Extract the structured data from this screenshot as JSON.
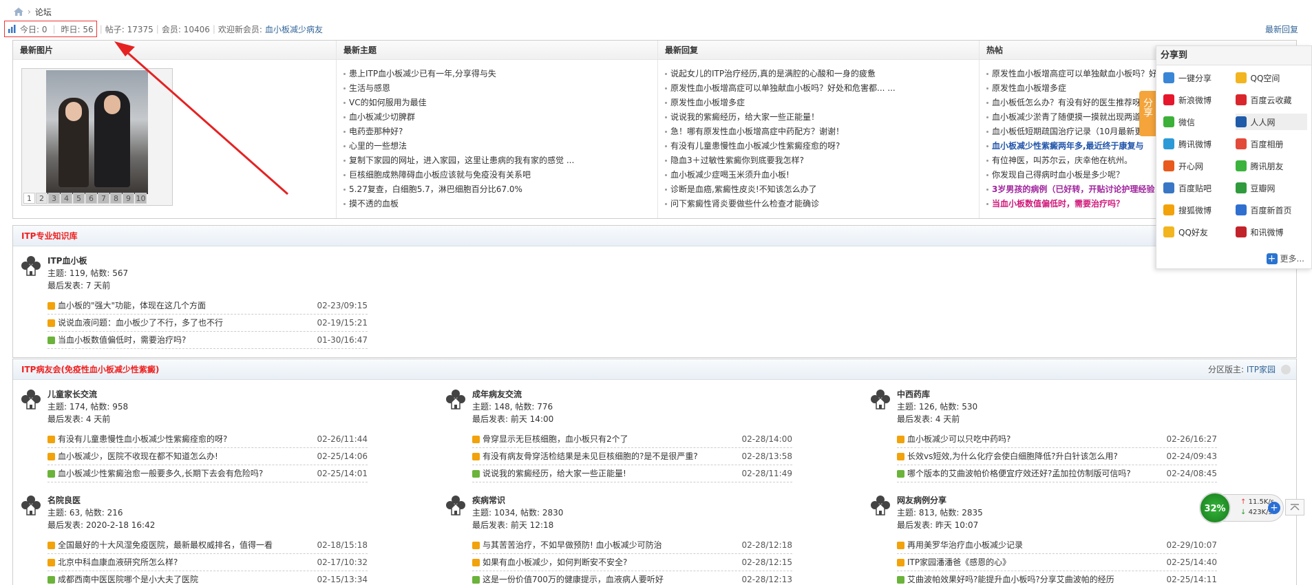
{
  "breadcrumb": {
    "current": "论坛"
  },
  "stats": {
    "today": "今日: 0",
    "yesterday": "昨日: 56",
    "posts": "帖子: 17375",
    "members": "会员: 10406",
    "welcome": "欢迎新会员:",
    "newest_member": "血小板减少病友"
  },
  "latest_reply_link": "最新回复",
  "hot": {
    "columns": [
      {
        "title": "最新图片"
      },
      {
        "title": "最新主题"
      },
      {
        "title": "最新回复"
      },
      {
        "title": "热帖"
      }
    ],
    "pager": [
      "1",
      "2",
      "3",
      "4",
      "5",
      "6",
      "7",
      "8",
      "9",
      "10"
    ],
    "new_topics": [
      "患上ITP血小板减少已有一年,分享得与失",
      "生活与感恩",
      "VC的如何服用为最佳",
      "血小板减少切脾群",
      "电药壶那种好?",
      "心里的一些想法",
      "复制下家园的网址，进入家园，这里让患病的我有家的感觉 ...",
      "巨核细胞成熟障碍血小板应该就与免疫没有关系吧",
      "5.27复查，白细胞5.7，淋巴细胞百分比67.0%",
      "摸不透的血板"
    ],
    "new_replies": [
      "说起女儿的ITP治疗经历,真的是满腔的心酸和一身的疲惫",
      "原发性血小板增高症可以单独献血小板吗？好处和危害都... ...",
      "原发性血小板增多症",
      "说说我的紫癜经历，给大家一些正能量！",
      "急！哪有原发性血小板增高症中药配方？谢谢！",
      "有没有儿童患慢性血小板减少性紫癜痊愈的呀?",
      "隐血3＋过敏性紫癜你到底要我怎样?",
      "血小板减少症喝玉米须升血小板!",
      "诊断是血癌,紫癜性皮炎!不知该怎么办了",
      "问下紫癜性肾炎要做些什么检查才能确诊"
    ],
    "hot_posts": [
      {
        "text": "原发性血小板增高症可以单独献血小板吗？好",
        "style": ""
      },
      {
        "text": "原发性血小板增多症",
        "style": ""
      },
      {
        "text": "血小板低怎么办？有没有好的医生推荐呀",
        "style": ""
      },
      {
        "text": "血小板减少淤青了随便摸一摸就出现两道",
        "style": ""
      },
      {
        "text": "血小板低短期疏国治疗记录（10月最新更",
        "style": ""
      },
      {
        "text": "血小板减少性紫癜两年多,最近终于康复与",
        "style": "bold-blue"
      },
      {
        "text": "有位神医，叫苏尔云，庆幸他在杭州。",
        "style": ""
      },
      {
        "text": "你发现自己得病时血小板是多少呢？",
        "style": ""
      },
      {
        "text": "3岁男孩的病例（已好转，开贴讨论护理经验",
        "style": "bold-purple"
      },
      {
        "text": "当血小板数值偏低时，需要治疗吗？",
        "style": "bold-pink"
      }
    ]
  },
  "sections": [
    {
      "title": "ITP专业知识库",
      "forums": [
        {
          "name": "ITP血小板",
          "stats": "主题: 119, 帖数: 567",
          "last": "最后发表: 7 天前",
          "threads": [
            {
              "title": "血小板的\"强大\"功能，体现在这几个方面",
              "date": "02-23/09:15",
              "icon": "o"
            },
            {
              "title": "说说血液问题：血小板少了不行，多了也不行",
              "date": "02-19/15:21",
              "icon": "o"
            },
            {
              "title": "当血小板数值偏低时，需要治疗吗?",
              "date": "01-30/16:47",
              "icon": "g"
            }
          ]
        }
      ]
    },
    {
      "title": "ITP病友会(免疫性血小板减少性紫癜)",
      "moderator_label": "分区版主:",
      "moderator": "ITP家园",
      "forums": [
        {
          "name": "儿童家长交流",
          "stats": "主题: 174, 帖数: 958",
          "last": "最后发表: 4 天前",
          "threads": [
            {
              "title": "有没有儿童患慢性血小板减少性紫癜痊愈的呀?",
              "date": "02-26/11:44",
              "icon": "o"
            },
            {
              "title": "血小板减少，医院不收现在都不知道怎么办!",
              "date": "02-25/14:06",
              "icon": "o"
            },
            {
              "title": "血小板减少性紫癜治愈一般要多久,长期下去会有危险吗?",
              "date": "02-25/14:01",
              "icon": "g"
            }
          ]
        },
        {
          "name": "成年病友交流",
          "stats": "主题: 148, 帖数: 776",
          "last": "最后发表: 前天 14:00",
          "threads": [
            {
              "title": "骨穿显示无巨核细胞，血小板只有2个了",
              "date": "02-28/14:00",
              "icon": "o"
            },
            {
              "title": "有没有病友骨穿活检结果是未见巨核细胞的?是不是很严重?",
              "date": "02-28/13:58",
              "icon": "o"
            },
            {
              "title": "说说我的紫癜经历，给大家一些正能量!",
              "date": "02-28/11:49",
              "icon": "g"
            }
          ]
        },
        {
          "name": "中西药库",
          "stats": "主题: 126, 帖数: 530",
          "last": "最后发表: 4 天前",
          "threads": [
            {
              "title": "血小板减少可以只吃中药吗?",
              "date": "02-26/16:27",
              "icon": "o"
            },
            {
              "title": "长效vs短效,为什么化疗会使白细胞降低?升白针该怎么用?",
              "date": "02-24/09:43",
              "icon": "o"
            },
            {
              "title": "哪个版本的艾曲波帕价格便宜疗效还好?孟加拉仿制版可信吗?",
              "date": "02-24/08:45",
              "icon": "g"
            }
          ]
        },
        {
          "name": "名院良医",
          "stats": "主题: 63, 帖数: 216",
          "last": "最后发表: 2020-2-18 16:42",
          "threads": [
            {
              "title": "全国最好的十大风湿免疫医院，最新最权威排名，值得一看",
              "date": "02-18/15:18",
              "icon": "o"
            },
            {
              "title": "北京中科血康血液研究所怎么样?",
              "date": "02-17/10:32",
              "icon": "o"
            },
            {
              "title": "成都西南中医医院哪个是小大夫了医院",
              "date": "02-15/13:34",
              "icon": "g"
            }
          ]
        },
        {
          "name": "疾病常识",
          "stats": "主题: 1034, 帖数: 2830",
          "last": "最后发表: 前天 12:18",
          "threads": [
            {
              "title": "与其苦苦治疗，不如早做预防! 血小板减少可防治",
              "date": "02-28/12:18",
              "icon": "o"
            },
            {
              "title": "如果有血小板减少，如何判断安不安全?",
              "date": "02-28/12:15",
              "icon": "o"
            },
            {
              "title": "这是一份价值700万的健康提示，血液病人要听好",
              "date": "02-28/12:13",
              "icon": "g"
            }
          ]
        },
        {
          "name": "网友病例分享",
          "stats": "主题: 813, 帖数: 2835",
          "last": "最后发表: 昨天 10:07",
          "threads": [
            {
              "title": "再用美罗华治疗血小板减少记录",
              "date": "02-29/10:07",
              "icon": "o"
            },
            {
              "title": "ITP家园潘潘爸《感恩的心》",
              "date": "02-25/14:40",
              "icon": "o"
            },
            {
              "title": "艾曲波帕效果好吗?能提升血小板吗?分享艾曲波帕的经历",
              "date": "02-25/14:11",
              "icon": "g"
            }
          ]
        }
      ]
    }
  ],
  "share": {
    "title": "分享到",
    "tab": "分享",
    "items": [
      {
        "label": "一键分享",
        "color": "#3a86d6",
        "icon": "one-click-share-icon"
      },
      {
        "label": "QQ空间",
        "color": "#f2b51f",
        "icon": "qzone-icon"
      },
      {
        "label": "新浪微博",
        "color": "#e6162d",
        "icon": "weibo-icon"
      },
      {
        "label": "百度云收藏",
        "color": "#d9262c",
        "icon": "heart-icon"
      },
      {
        "label": "微信",
        "color": "#3db03a",
        "icon": "wechat-icon"
      },
      {
        "label": "人人网",
        "color": "#1f5ba8",
        "icon": "renren-icon"
      },
      {
        "label": "腾讯微博",
        "color": "#2d9ad8",
        "icon": "tencent-weibo-icon"
      },
      {
        "label": "百度相册",
        "color": "#e24a3a",
        "icon": "baidu-album-icon"
      },
      {
        "label": "开心网",
        "color": "#e85a1d",
        "icon": "kaixin-icon"
      },
      {
        "label": "腾讯朋友",
        "color": "#3bb33c",
        "icon": "tencent-friend-icon"
      },
      {
        "label": "百度贴吧",
        "color": "#3977c6",
        "icon": "tieba-icon"
      },
      {
        "label": "豆瓣网",
        "color": "#2f9b3c",
        "icon": "douban-icon"
      },
      {
        "label": "搜狐微博",
        "color": "#f2a20b",
        "icon": "sohu-icon"
      },
      {
        "label": "百度新首页",
        "color": "#2f6fd0",
        "icon": "baidu-home-icon"
      },
      {
        "label": "QQ好友",
        "color": "#f2b51f",
        "icon": "qq-icon"
      },
      {
        "label": "和讯微博",
        "color": "#c2232a",
        "icon": "hexun-icon"
      }
    ],
    "more": "更多..."
  },
  "speed": {
    "percent": "32%",
    "up": "11.5K/s",
    "down": "423K/s",
    "plus": "+"
  }
}
